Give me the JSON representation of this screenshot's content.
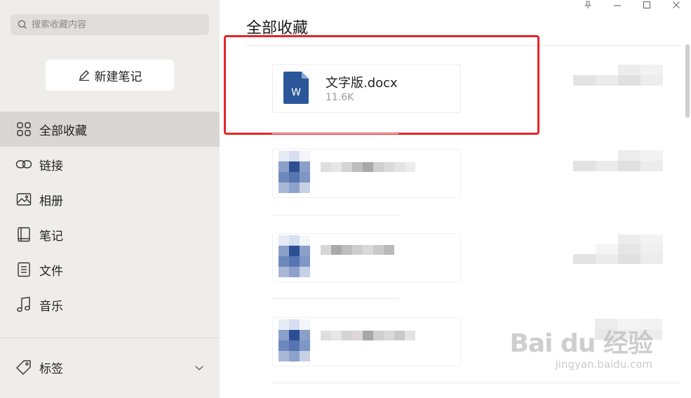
{
  "sidebar": {
    "search": {
      "placeholder": "搜索收藏内容",
      "value": ""
    },
    "new_note_label": "新建笔记",
    "items": [
      {
        "label": "全部收藏",
        "icon": "grid-icon",
        "active": true
      },
      {
        "label": "链接",
        "icon": "link-icon",
        "active": false
      },
      {
        "label": "相册",
        "icon": "image-icon",
        "active": false
      },
      {
        "label": "笔记",
        "icon": "notebook-icon",
        "active": false
      },
      {
        "label": "文件",
        "icon": "document-icon",
        "active": false
      },
      {
        "label": "音乐",
        "icon": "music-note-icon",
        "active": false
      }
    ],
    "tags_label": "标签"
  },
  "main": {
    "title": "全部收藏",
    "files": [
      {
        "name": "文字版.docx",
        "size": "11.6K",
        "type": "word"
      }
    ],
    "highlight_color": "#e8232a"
  },
  "colors": {
    "sidebar_bg": "#efedec",
    "sidebar_active": "#d9d7d6",
    "word_blue": "#2b579a"
  },
  "watermark": {
    "logo": "Bai du 经验",
    "url": "jingyan.baidu.com"
  }
}
